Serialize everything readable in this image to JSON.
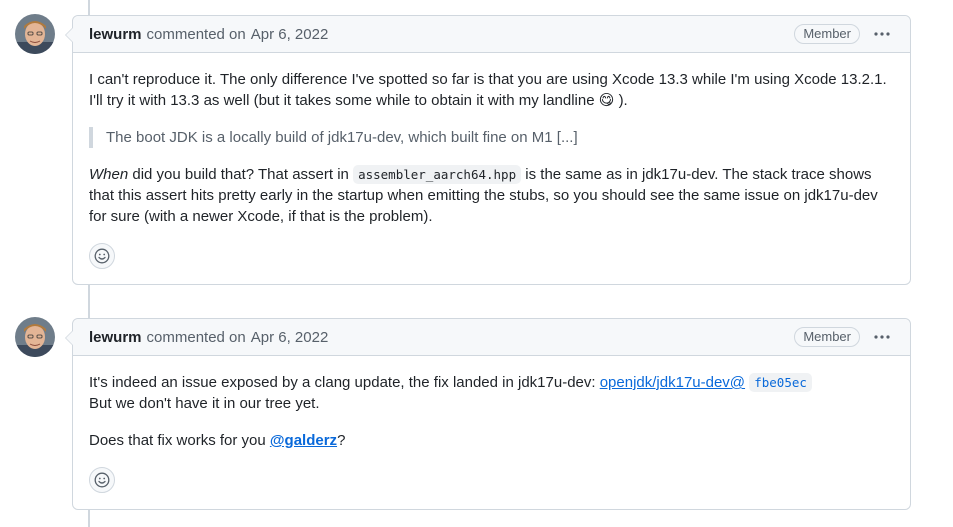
{
  "comments": [
    {
      "author": "lewurm",
      "action": "commented on",
      "date": "Apr 6, 2022",
      "badge": "Member",
      "p1_text": "I can't reproduce it. The only difference I've spotted so far is that you are using Xcode 13.3 while I'm using Xcode 13.2.1. I'll try it with 13.3 as well (but it takes some while to obtain it with my landline",
      "p1_emoji": "😋",
      "p1_end": ").",
      "quote": "The boot JDK is a locally build of jdk17u-dev, which built fine on M1 [...]",
      "p2_em": "When",
      "p2_a": " did you build that? That assert in ",
      "p2_code": "assembler_aarch64.hpp",
      "p2_b": " is the same as in jdk17u-dev. The stack trace shows that this assert hits pretty early in the startup when emitting the stubs, so you should see the same issue on jdk17u-dev for sure (with a newer Xcode, if that is the problem)."
    },
    {
      "author": "lewurm",
      "action": "commented on",
      "date": "Apr 6, 2022",
      "badge": "Member",
      "l1_text": "It's indeed an issue exposed by a clang update, the fix landed in jdk17u-dev: ",
      "l1_link": "openjdk/jdk17u-dev@",
      "l1_code": "fbe05ec",
      "l2_text": "But we don't have it in our tree yet.",
      "p2_text": "Does that fix works for you ",
      "p2_mention": "@galderz",
      "p2_end": "?"
    }
  ]
}
